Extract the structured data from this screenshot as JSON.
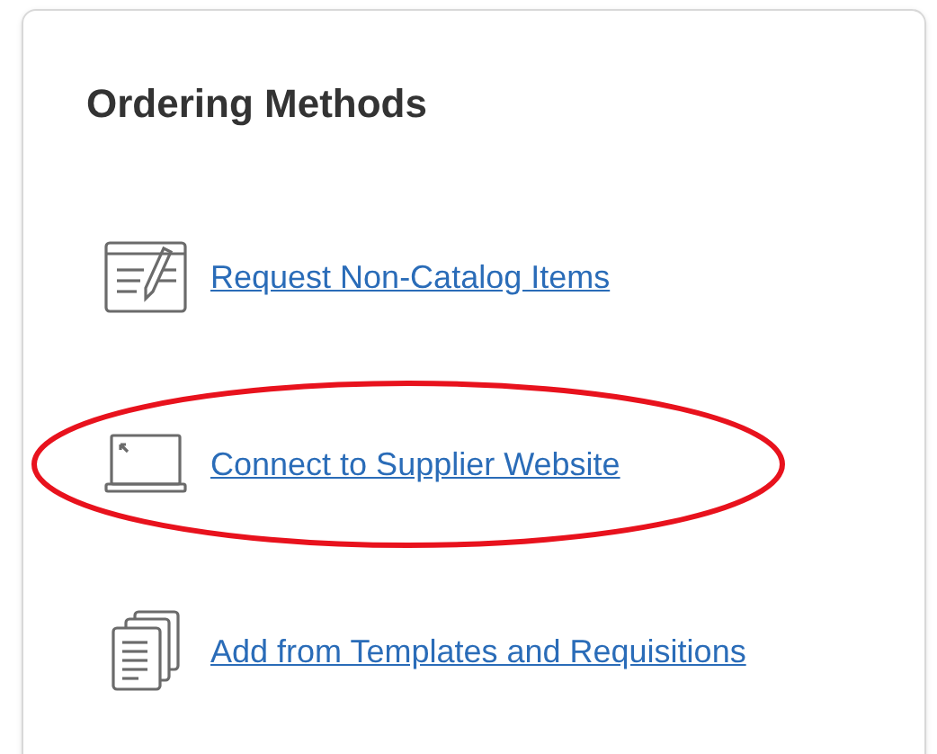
{
  "panel": {
    "title": "Ordering Methods"
  },
  "methods": [
    {
      "kind": "request",
      "label": "Request Non-Catalog Items",
      "circled": false
    },
    {
      "kind": "connect",
      "label": "Connect to Supplier Website",
      "circled": true
    },
    {
      "kind": "templates",
      "label": "Add from Templates and Requisitions",
      "circled": false
    }
  ]
}
